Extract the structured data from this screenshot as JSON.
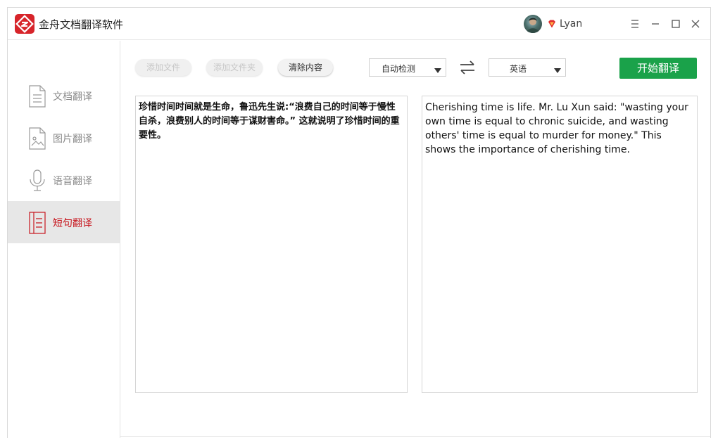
{
  "app": {
    "title": "金舟文档翻译软件"
  },
  "user": {
    "name": "Lyan"
  },
  "colors": {
    "accent": "#c7161e",
    "start_button": "#1aa24a",
    "logo": "#d7242a"
  },
  "sidebar": {
    "items": [
      {
        "label": "文档翻译",
        "icon": "document-icon",
        "active": false
      },
      {
        "label": "图片翻译",
        "icon": "image-icon",
        "active": false
      },
      {
        "label": "语音翻译",
        "icon": "microphone-icon",
        "active": false
      },
      {
        "label": "短句翻译",
        "icon": "sentence-icon",
        "active": true
      }
    ]
  },
  "toolbar": {
    "add_file_label": "添加文件",
    "add_folder_label": "添加文件夹",
    "clear_label": "清除内容",
    "source_language": "自动检测",
    "target_language": "英语",
    "start_label": "开始翻译"
  },
  "source": {
    "text": "珍惜时间时间就是生命，鲁迅先生说:“浪费自己的时间等于慢性自杀，浪费别人的时间等于谋财害命。” 这就说明了珍惜时间的重要性。"
  },
  "target": {
    "text": "Cherishing time is life. Mr. Lu Xun said: \"wasting your own time is equal to chronic suicide, and wasting others' time is equal to murder for money.\" This shows the importance of cherishing time."
  }
}
